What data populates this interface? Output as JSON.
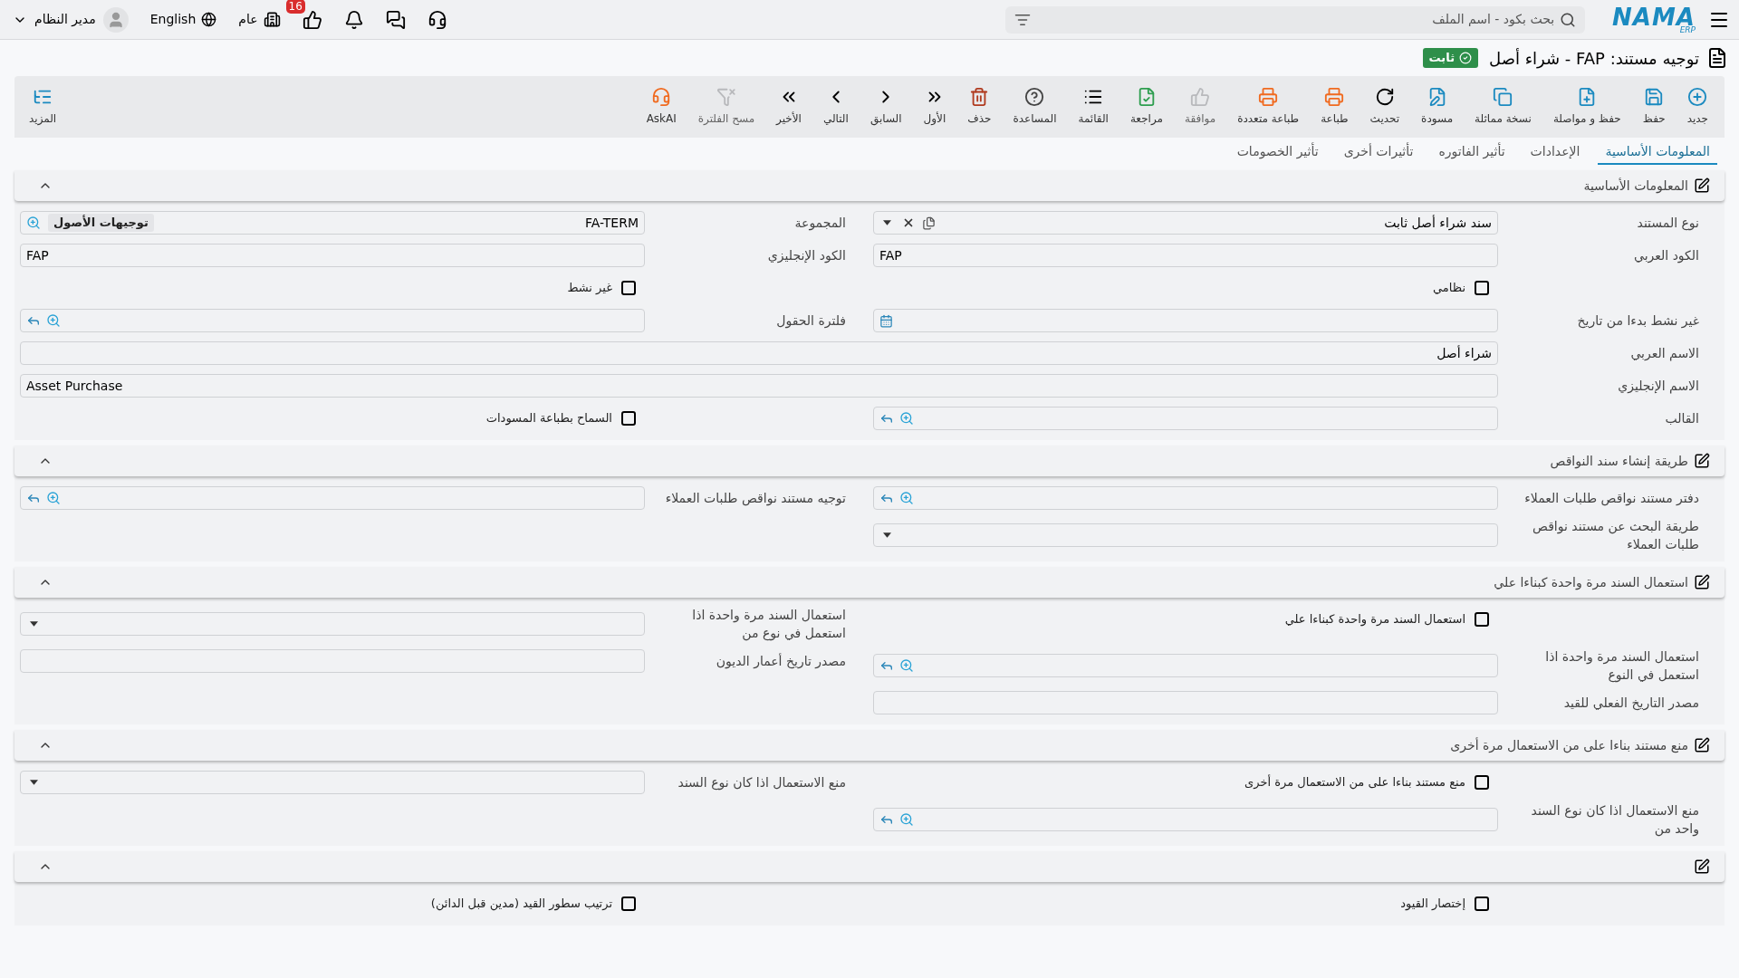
{
  "top_bar": {
    "search": {
      "placeholder": "بحث بكود - اسم الملف"
    },
    "logo": {
      "name": "NAMA",
      "sub": "ERP"
    },
    "likes": {
      "count": "16"
    },
    "company": {
      "label": "عام"
    },
    "language": {
      "label": "English"
    },
    "user": {
      "name": "مدير النظام"
    }
  },
  "header": {
    "title": "توجيه مستند: FAP - شراء أصل",
    "status": "ثابت"
  },
  "toolbar": {
    "buttons": [
      {
        "kind": "new",
        "label": "جديد",
        "disabled": false
      },
      {
        "kind": "save",
        "label": "حفظ",
        "disabled": false
      },
      {
        "kind": "save-continue",
        "label": "حفظ و مواصلة",
        "disabled": false
      },
      {
        "kind": "duplicate",
        "label": "نسخة مماثلة",
        "disabled": false
      },
      {
        "kind": "draft",
        "label": "مسودة",
        "disabled": false
      },
      {
        "kind": "refresh",
        "label": "تحديث",
        "disabled": false
      },
      {
        "kind": "print",
        "label": "طباعة",
        "disabled": false
      },
      {
        "kind": "multi-print",
        "label": "طباعة متعددة",
        "disabled": false
      },
      {
        "kind": "approve",
        "label": "موافقة",
        "disabled": true
      },
      {
        "kind": "review",
        "label": "مراجعة",
        "disabled": false
      },
      {
        "kind": "list",
        "label": "القائمة",
        "disabled": false
      },
      {
        "kind": "help",
        "label": "المساعدة",
        "disabled": false
      },
      {
        "kind": "delete",
        "label": "حذف",
        "disabled": false
      },
      {
        "kind": "first",
        "label": "الأول",
        "disabled": false
      },
      {
        "kind": "previous",
        "label": "السابق",
        "disabled": false
      },
      {
        "kind": "next",
        "label": "التالي",
        "disabled": false
      },
      {
        "kind": "last",
        "label": "الأخير",
        "disabled": false
      },
      {
        "kind": "clear-filter",
        "label": "مسح الفلترة",
        "disabled": true
      },
      {
        "kind": "ask-ai",
        "label": "AskAI",
        "disabled": false
      }
    ],
    "more": {
      "label": "المزيد"
    }
  },
  "tabs": [
    {
      "label": "المعلومات الأساسية",
      "selected": true
    },
    {
      "label": "الإعدادات",
      "selected": false
    },
    {
      "label": "تأثير الفاتوره",
      "selected": false
    },
    {
      "label": "تأثيرات أخرى",
      "selected": false
    },
    {
      "label": "تأثير الخصومات",
      "selected": false
    }
  ],
  "sections": [
    {
      "title": "المعلومات الأساسية",
      "expanded": true,
      "rows": [
        {
          "kind": "pair",
          "cells": [
            {
              "kind": "select",
              "label": "نوع المستند",
              "value": "سند شراء أصل ثابت"
            },
            {
              "kind": "group",
              "label": "المجموعة",
              "value": "FA-TERM",
              "tag": "توجيهات الأصول"
            }
          ]
        },
        {
          "kind": "pair",
          "cells": [
            {
              "kind": "text",
              "label": "الكود العربي",
              "value": "FAP"
            },
            {
              "kind": "text",
              "label": "الكود الإنجليزي",
              "value": "FAP"
            }
          ]
        },
        {
          "kind": "pair",
          "cells": [
            {
              "kind": "checkbox",
              "label": "نظامي",
              "checked": false
            },
            {
              "kind": "checkbox",
              "label": "غير نشط",
              "checked": false
            }
          ]
        },
        {
          "kind": "pair",
          "cells": [
            {
              "kind": "date",
              "label": "غير نشط بدءا من تاريخ"
            },
            {
              "kind": "lookup",
              "label": "فلترة الحقول"
            }
          ]
        },
        {
          "kind": "wide",
          "cells": [
            {
              "kind": "text",
              "label": "الاسم العربي",
              "value": "شراء أصل"
            }
          ]
        },
        {
          "kind": "wide",
          "cells": [
            {
              "kind": "text",
              "label": "الاسم الإنجليزي",
              "value": "Asset Purchase"
            }
          ]
        },
        {
          "kind": "pair",
          "cells": [
            {
              "kind": "lookup",
              "label": "القالب"
            },
            {
              "kind": "checkbox",
              "label": "السماح بطباعة المسودات",
              "checked": false
            }
          ]
        }
      ]
    },
    {
      "title": "طريقة إنشاء سند النواقص",
      "expanded": true,
      "rows": [
        {
          "kind": "pair",
          "cells": [
            {
              "kind": "lookup",
              "label": "دفتر مستند نواقص طلبات العملاء"
            },
            {
              "kind": "lookup",
              "label": "توجيه مستند نواقص طلبات العملاء"
            }
          ]
        },
        {
          "kind": "pair",
          "cells": [
            {
              "kind": "dropdown",
              "label": "طريقة البحث عن مستند نواقص طلبات العملاء"
            }
          ]
        }
      ]
    },
    {
      "title": "استعمال السند مرة واحدة كبناءا علي",
      "expanded": true,
      "rows": [
        {
          "kind": "pair",
          "cells": [
            {
              "kind": "checkbox",
              "label": "استعمال السند مرة واحدة كبناءا علي",
              "checked": false
            },
            {
              "kind": "dropdown",
              "label": "استعمال السند مرة واحدة اذا استعمل في نوع من"
            }
          ]
        },
        {
          "kind": "pair",
          "cells": [
            {
              "kind": "lookup",
              "label": "استعمال السند مرة واحدة اذا استعمل في النوع"
            },
            {
              "kind": "text",
              "label": "مصدر تاريخ أعمار الديون"
            }
          ]
        },
        {
          "kind": "pair",
          "cells": [
            {
              "kind": "text",
              "label": "مصدر التاريخ الفعلي للقيد"
            }
          ]
        }
      ]
    },
    {
      "title": "منع مستند بناءا على من الاستعمال مرة أخرى",
      "expanded": true,
      "rows": [
        {
          "kind": "pair",
          "cells": [
            {
              "kind": "checkbox",
              "label": "منع مستند بناءا على من الاستعمال مرة أخرى",
              "checked": false
            },
            {
              "kind": "dropdown",
              "label": "منع الاستعمال اذا كان نوع السند"
            }
          ]
        },
        {
          "kind": "pair",
          "cells": [
            {
              "kind": "lookup",
              "label": "منع الاستعمال اذا كان نوع السند واحد من"
            }
          ]
        }
      ]
    },
    {
      "expanded": true,
      "rows": [
        {
          "kind": "pair",
          "cells": [
            {
              "kind": "checkbox",
              "label": "إختصار القيود",
              "checked": false
            },
            {
              "kind": "checkbox",
              "label": "ترتيب سطور القيد (مدين قبل الدائن)",
              "checked": false
            }
          ]
        }
      ]
    }
  ]
}
